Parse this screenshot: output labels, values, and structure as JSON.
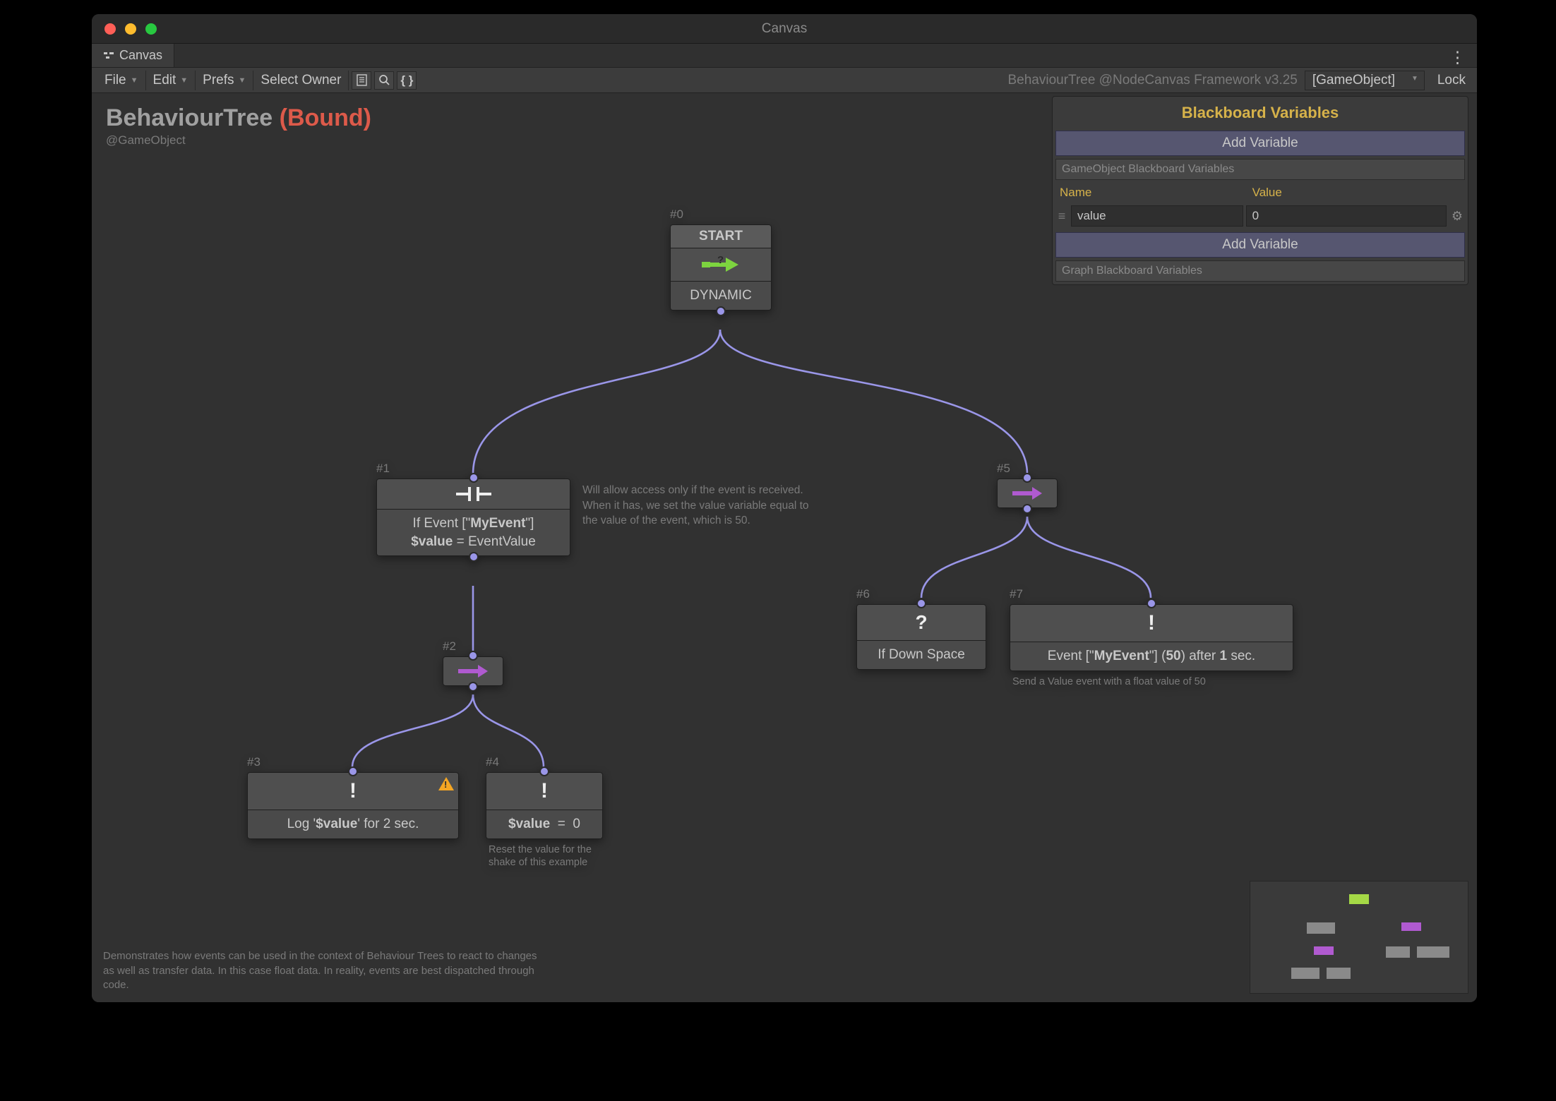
{
  "window": {
    "title": "Canvas"
  },
  "tab": {
    "label": "Canvas"
  },
  "toolbar": {
    "file": "File",
    "edit": "Edit",
    "prefs": "Prefs",
    "select_owner": "Select Owner",
    "version": "BehaviourTree @NodeCanvas Framework v3.25",
    "owner_selector": "[GameObject]",
    "lock": "Lock"
  },
  "graph": {
    "title_main": "BehaviourTree ",
    "title_status": "(Bound)",
    "subtitle": "@GameObject",
    "description": "Demonstrates how events can be used in the context of Behaviour Trees to react to changes as well as transfer data. In this case float data. In reality, events are best dispatched through code."
  },
  "nodes": {
    "n0": {
      "idx": "#0",
      "head": "START",
      "body": "DYNAMIC"
    },
    "n1": {
      "idx": "#1",
      "line1": "If Event [\"MyEvent\"]",
      "line2": "$value = EventValue",
      "comment": "Will allow access only if the event is received. When it has, we set the value variable equal to the value of the event, which is 50."
    },
    "n2": {
      "idx": "#2"
    },
    "n3": {
      "idx": "#3",
      "body": "Log '$value' for 2 sec."
    },
    "n4": {
      "idx": "#4",
      "body": "$value  =  0",
      "foot": "Reset the value for the shake of this example"
    },
    "n5": {
      "idx": "#5"
    },
    "n6": {
      "idx": "#6",
      "body": "If Down Space"
    },
    "n7": {
      "idx": "#7",
      "body": "Event [\"MyEvent\"] (50) after 1 sec.",
      "foot": "Send a Value event with a float value of 50"
    }
  },
  "blackboard": {
    "title": "Blackboard Variables",
    "add": "Add Variable",
    "sect1": "GameObject Blackboard Variables",
    "col_name": "Name",
    "col_value": "Value",
    "var_name": "value",
    "var_value": "0",
    "sect2": "Graph Blackboard Variables"
  }
}
